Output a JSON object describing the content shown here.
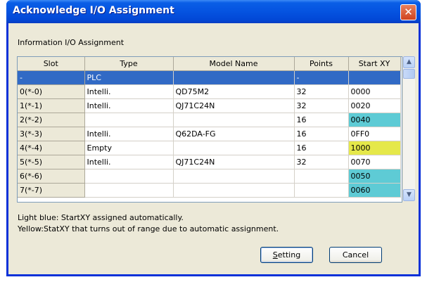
{
  "window": {
    "title": "Acknowledge I/O Assignment",
    "close_glyph": "✕"
  },
  "section_label": "Information I/O Assignment",
  "table": {
    "columns": [
      "Slot",
      "Type",
      "Model Name",
      "Points",
      "Start XY"
    ],
    "rows": [
      {
        "slot": "-",
        "type": "PLC",
        "model": "",
        "points": "-",
        "start_xy": "",
        "selected": true
      },
      {
        "slot": "0(*-0)",
        "type": "Intelli.",
        "model": "QD75M2",
        "points": "32",
        "start_xy": "0000"
      },
      {
        "slot": "1(*-1)",
        "type": "Intelli.",
        "model": "QJ71C24N",
        "points": "32",
        "start_xy": "0020"
      },
      {
        "slot": "2(*-2)",
        "type": "",
        "model": "",
        "points": "16",
        "start_xy": "0040",
        "highlight": "auto"
      },
      {
        "slot": "3(*-3)",
        "type": "Intelli.",
        "model": "Q62DA-FG",
        "points": "16",
        "start_xy": "0FF0"
      },
      {
        "slot": "4(*-4)",
        "type": "Empty",
        "model": "",
        "points": "16",
        "start_xy": "1000",
        "highlight": "range"
      },
      {
        "slot": "5(*-5)",
        "type": "Intelli.",
        "model": "QJ71C24N",
        "points": "32",
        "start_xy": "0070"
      },
      {
        "slot": "6(*-6)",
        "type": "",
        "model": "",
        "points": "",
        "start_xy": "0050",
        "highlight": "auto"
      },
      {
        "slot": "7(*-7)",
        "type": "",
        "model": "",
        "points": "",
        "start_xy": "0060",
        "highlight": "auto"
      }
    ]
  },
  "colors": {
    "auto": "#5ecbd5",
    "range": "#e5e84a",
    "selected": "#316ac5"
  },
  "scrollbar": {
    "up_icon": "▲",
    "down_icon": "▼"
  },
  "notes": {
    "light_blue": "Light blue: StartXY assigned automatically.",
    "yellow": "Yellow:StatXY that turns out of range due to automatic assignment."
  },
  "buttons": {
    "setting_mnemonic": "S",
    "setting_rest": "etting",
    "cancel": "Cancel"
  }
}
